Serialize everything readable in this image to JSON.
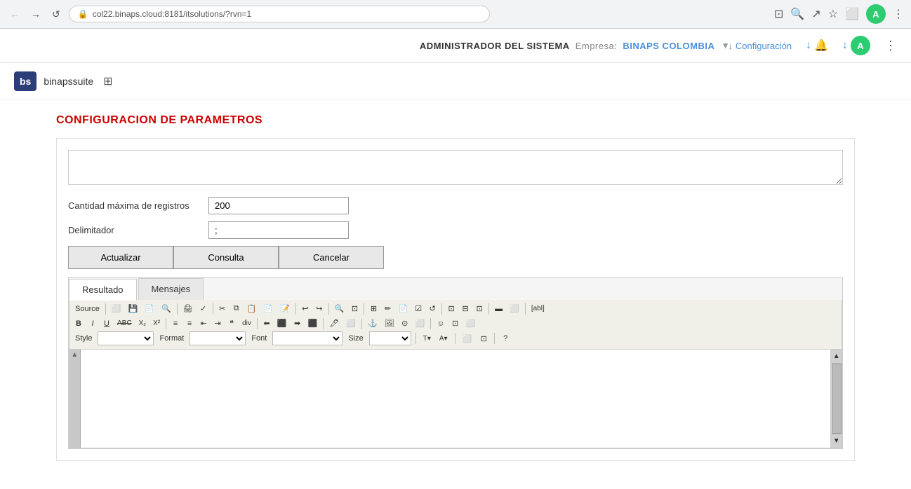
{
  "browser": {
    "url": "col22.binaps.cloud:8181/itsolutions/?rvn=1",
    "back_disabled": true,
    "forward_disabled": false
  },
  "topbar": {
    "admin_label": "ADMINISTRADOR DEL SISTEMA",
    "empresa_label": "Empresa:",
    "empresa_name": "BINAPS COLOMBIA",
    "config_label": "Configuración",
    "arrow_down": "↓"
  },
  "header": {
    "logo_bs": "bs",
    "logo_text": "binapssuite"
  },
  "main": {
    "section_title": "CONFIGURACION DE PARAMETROS",
    "textarea_placeholder": "",
    "fields": [
      {
        "label": "Cantidad máxima de registros",
        "value": "200"
      },
      {
        "label": "Delimitador",
        "value": ";"
      }
    ],
    "buttons": [
      {
        "label": "Actualizar"
      },
      {
        "label": "Consulta"
      },
      {
        "label": "Cancelar"
      }
    ],
    "tabs": [
      {
        "label": "Resultado",
        "active": true
      },
      {
        "label": "Mensajes",
        "active": false
      }
    ]
  },
  "editor": {
    "toolbar_row1": [
      {
        "label": "Source",
        "name": "source-btn"
      },
      {
        "label": "⬜",
        "name": "templates-btn"
      },
      {
        "label": "💾",
        "name": "save-btn"
      },
      {
        "label": "📄",
        "name": "new-btn"
      },
      {
        "label": "🔍",
        "name": "preview-btn"
      },
      {
        "label": "📋",
        "name": "print-btn"
      },
      {
        "label": "✂",
        "name": "cut-btn"
      },
      {
        "label": "📋",
        "name": "copy-btn"
      },
      {
        "label": "📋",
        "name": "paste-btn"
      },
      {
        "label": "📋",
        "name": "paste-text-btn"
      },
      {
        "label": "🖨",
        "name": "print2-btn"
      },
      {
        "label": "✓",
        "name": "spellcheck-btn"
      },
      {
        "label": "↩",
        "name": "undo-btn"
      },
      {
        "label": "↪",
        "name": "redo-btn"
      },
      {
        "label": "🔍",
        "name": "find-btn"
      },
      {
        "label": "A↕",
        "name": "select-all-btn"
      },
      {
        "label": "⊞",
        "name": "table-btn"
      },
      {
        "label": "✏",
        "name": "draw-btn"
      },
      {
        "label": "📄",
        "name": "page-break-btn"
      },
      {
        "label": "☑",
        "name": "checkbox-btn"
      },
      {
        "label": "↺",
        "name": "iframe-btn"
      },
      {
        "label": "⊡",
        "name": "flash-btn"
      },
      {
        "label": "⊟",
        "name": "form-btn"
      },
      {
        "label": "⊡",
        "name": "hidden-btn"
      },
      {
        "label": "▬",
        "name": "hline-btn"
      },
      {
        "label": "⬜",
        "name": "special-btn"
      },
      {
        "label": "[abl]",
        "name": "abl-btn"
      }
    ],
    "toolbar_row2_bold": "B",
    "toolbar_row2_italic": "I",
    "toolbar_row2_underline": "U",
    "toolbar_row2_strike": "ABC",
    "toolbar_row2_sub": "X₂",
    "toolbar_row2_sup": "X²",
    "toolbar_row2_items": [
      {
        "label": "≡",
        "name": "ol-btn"
      },
      {
        "label": "≡",
        "name": "ul-btn"
      },
      {
        "label": "⇤",
        "name": "outdent-btn"
      },
      {
        "label": "⇥",
        "name": "indent-btn"
      },
      {
        "label": "❝",
        "name": "blockquote-btn"
      },
      {
        "label": "div",
        "name": "div-btn"
      },
      {
        "label": "⬅",
        "name": "align-left-btn"
      },
      {
        "label": "⬛",
        "name": "align-center-btn"
      },
      {
        "label": "➡",
        "name": "align-right-btn"
      },
      {
        "label": "⬛",
        "name": "align-justify-btn"
      },
      {
        "label": "🖊",
        "name": "textstyle-btn"
      },
      {
        "label": "⬜",
        "name": "removeformat-btn"
      },
      {
        "label": "⚓",
        "name": "anchor-btn"
      },
      {
        "label": "🖼",
        "name": "image-btn"
      },
      {
        "label": "⊙",
        "name": "smiley-btn"
      },
      {
        "label": "⬜",
        "name": "specialchar-btn"
      },
      {
        "label": "☺",
        "name": "emoji-btn"
      },
      {
        "label": "⬜",
        "name": "extra-btn"
      }
    ],
    "toolbar_row3": {
      "style_label": "Style",
      "format_label": "Format",
      "font_label": "Font",
      "size_label": "Size"
    }
  }
}
